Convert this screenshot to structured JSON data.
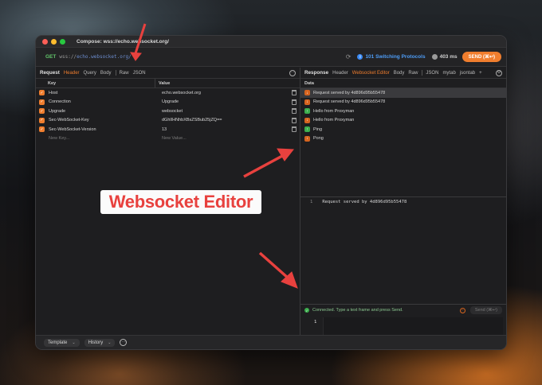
{
  "window": {
    "title": "Compose: wss://echo.websocket.org/"
  },
  "urlbar": {
    "method": "GET",
    "scheme": "wss://",
    "url": "echo.websocket.org/",
    "status": "101 Switching Protocols",
    "time": "403 ms",
    "send_label": "SEND (⌘↩)"
  },
  "request": {
    "title": "Request",
    "tabs": [
      "Header",
      "Query",
      "Body",
      "Raw",
      "JSON"
    ],
    "columns": {
      "key": "Key",
      "value": "Value"
    },
    "headers": [
      {
        "key": "Host",
        "value": "echo.websocket.org"
      },
      {
        "key": "Connection",
        "value": "Upgrade"
      },
      {
        "key": "Upgrade",
        "value": "websocket"
      },
      {
        "key": "Sec-WebSocket-Key",
        "value": "dGhlIHNhbXBsZSBub25jZQ=="
      },
      {
        "key": "Sec-WebSocket-Version",
        "value": "13"
      }
    ],
    "new_key_placeholder": "New Key...",
    "new_value_placeholder": "New Value..."
  },
  "response": {
    "title": "Response",
    "tabs": [
      "Header",
      "Websocket Editor",
      "Body",
      "Raw",
      "JSON",
      "mytab",
      "jsontab"
    ],
    "add_tab": "+",
    "data_header": "Data",
    "messages": [
      {
        "direction": "down",
        "text": "Request served by 4d896d95b55478"
      },
      {
        "direction": "down",
        "text": "Request served by 4d896d95b55478"
      },
      {
        "direction": "up",
        "text": "Hello from Proxyman"
      },
      {
        "direction": "down",
        "text": "Hello from Proxyman"
      },
      {
        "direction": "up",
        "text": "Ping"
      },
      {
        "direction": "down",
        "text": "Pong"
      }
    ],
    "preview_line_number": "1",
    "preview_text": "Request served by 4d896d95b55478",
    "compose_status": "Connected. Type a text frame and press Send.",
    "compose_send": "Send (⌘↩)",
    "editor_line_number": "1"
  },
  "bottombar": {
    "template_label": "Template",
    "history_label": "History"
  },
  "callout": {
    "text": "Websocket Editor"
  },
  "colors": {
    "accent": "#f07e2e",
    "status_blue": "#4e9df7",
    "annotation_red": "#e8413e"
  }
}
